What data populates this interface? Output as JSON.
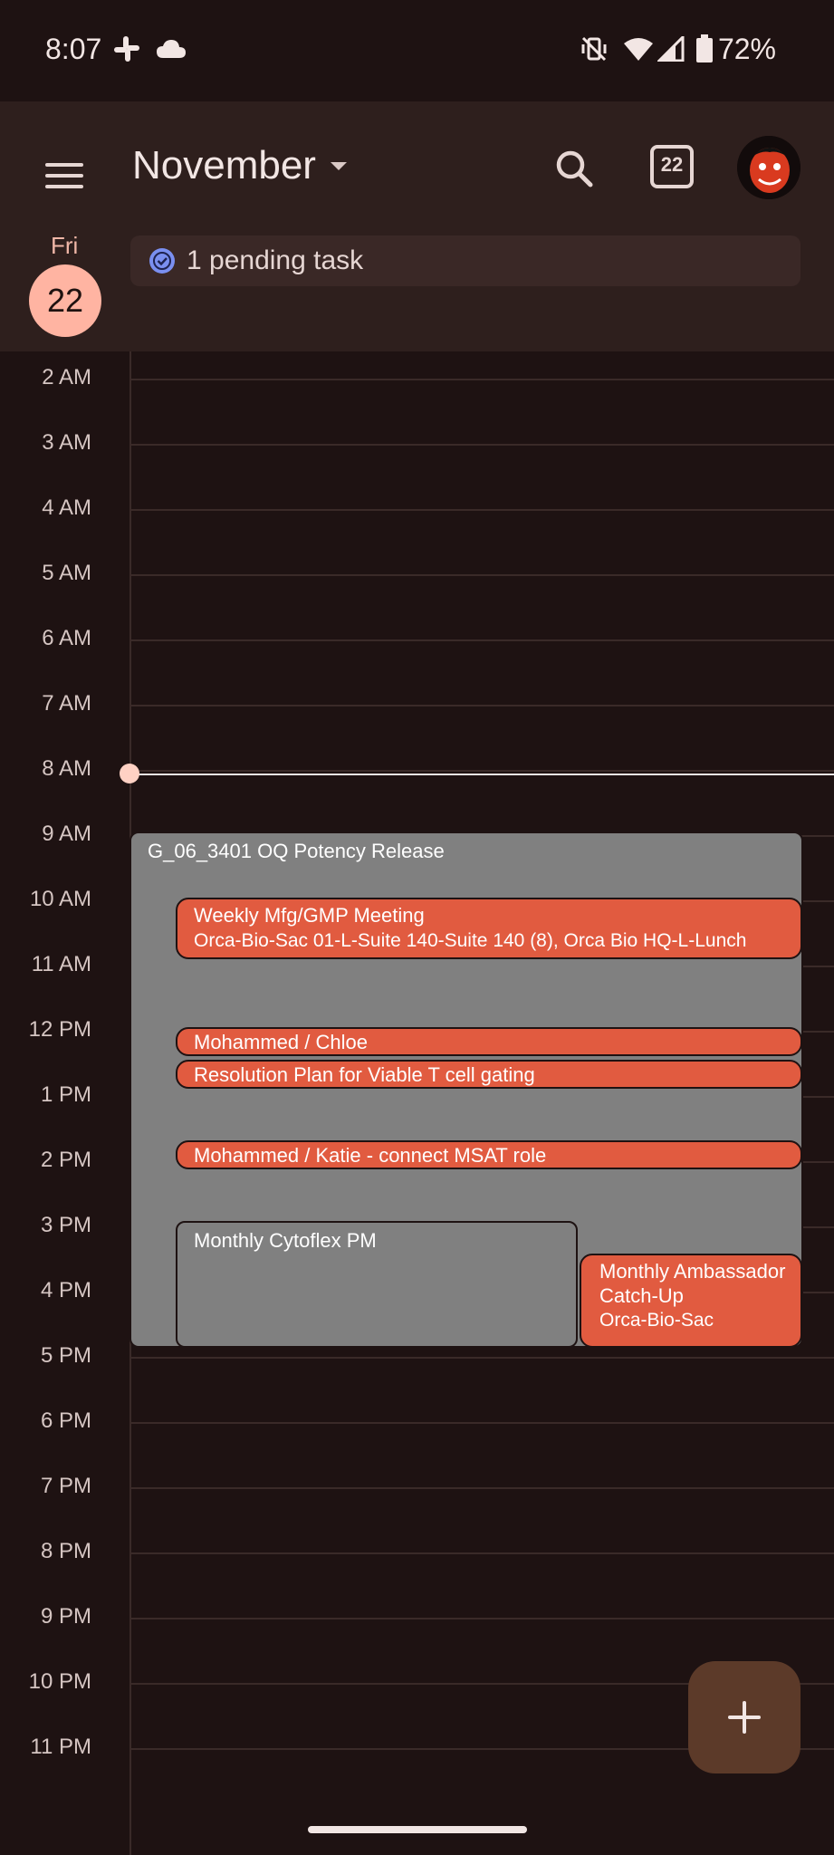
{
  "status_bar": {
    "time": "8:07",
    "battery": "72%"
  },
  "header": {
    "month": "November",
    "today_number": "22"
  },
  "day": {
    "name": "Fri",
    "number": "22"
  },
  "pending": {
    "label": "1 pending task"
  },
  "hours": [
    "2 AM",
    "3 AM",
    "4 AM",
    "5 AM",
    "6 AM",
    "7 AM",
    "8 AM",
    "9 AM",
    "10 AM",
    "11 AM",
    "12 PM",
    "1 PM",
    "2 PM",
    "3 PM",
    "4 PM",
    "5 PM",
    "6 PM",
    "7 PM",
    "8 PM",
    "9 PM",
    "10 PM",
    "11 PM"
  ],
  "events": [
    {
      "title": "G_06_3401 OQ Potency Release",
      "subtitle": ""
    },
    {
      "title": "Weekly Mfg/GMP Meeting",
      "subtitle": "Orca-Bio-Sac 01-L-Suite 140-Suite 140 (8), Orca Bio HQ-L-Lunch"
    },
    {
      "title": "Mohammed / Chloe",
      "subtitle": ""
    },
    {
      "title": "Resolution Plan for Viable T cell gating",
      "subtitle": ""
    },
    {
      "title": "Mohammed / Katie - connect MSAT role",
      "subtitle": ""
    },
    {
      "title": "Monthly Cytoflex PM",
      "subtitle": ""
    },
    {
      "title": "Monthly Ambassador Catch-Up",
      "subtitle": "Orca-Bio-Sac"
    }
  ],
  "colors": {
    "event_gray": "#808080",
    "event_orange": "#e15b40",
    "today_circle": "#ffb4a2",
    "fab": "#5c3a29"
  },
  "icons": [
    "slack-icon",
    "cloud-icon",
    "vibrate-off-icon",
    "wifi-icon",
    "signal-icon",
    "battery-icon",
    "menu-icon",
    "search-icon",
    "calendar-today-icon",
    "task-check-icon",
    "plus-icon"
  ]
}
